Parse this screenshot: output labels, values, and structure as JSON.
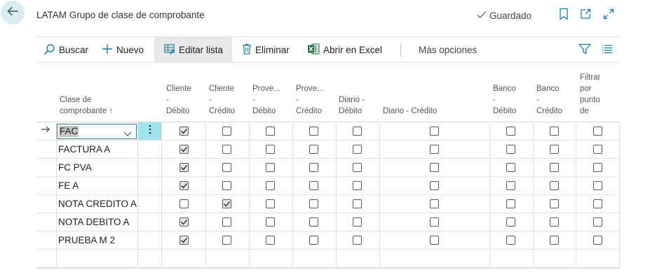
{
  "header": {
    "title": "LATAM Grupo de clase de comprobante",
    "saved_label": "Guardado"
  },
  "icons": {
    "back": "arrow-left-icon",
    "saved": "checkmark-icon",
    "bookmark": "bookmark-icon",
    "open_new": "open-in-new-window-icon",
    "expand": "expand-icon",
    "search": "search-icon",
    "new": "plus-icon",
    "edit_list": "edit-list-icon",
    "delete": "trash-icon",
    "excel": "excel-icon",
    "filter": "filter-icon",
    "list_view": "list-view-icon"
  },
  "actions": {
    "search": "Buscar",
    "new": "Nuevo",
    "edit_list": "Editar lista",
    "delete": "Eliminar",
    "excel": "Abrir en Excel",
    "more": "Más opciones"
  },
  "columns": [
    [
      "Clase de",
      "comprobante ↑"
    ],
    [
      "Cliente",
      "-",
      "Débito"
    ],
    [
      "Cliente",
      "-",
      "Crédito"
    ],
    [
      "Prove...",
      "-",
      "Débito"
    ],
    [
      "Prove...",
      "-",
      "Crédito"
    ],
    [
      "Diario -",
      "Débito"
    ],
    [
      "Diario - Crédito"
    ],
    [
      "Banco",
      "-",
      "Débito"
    ],
    [
      "Banco",
      "-",
      "Crédito"
    ],
    [
      "Filtrar",
      "por",
      "punto",
      "de"
    ]
  ],
  "rows": [
    {
      "code": "FAC",
      "checks": [
        true,
        false,
        false,
        false,
        false,
        false,
        false,
        false,
        false
      ]
    },
    {
      "code": "FACTURA A",
      "checks": [
        true,
        false,
        false,
        false,
        false,
        false,
        false,
        false,
        false
      ]
    },
    {
      "code": "FC PVA",
      "checks": [
        true,
        false,
        false,
        false,
        false,
        false,
        false,
        false,
        false
      ]
    },
    {
      "code": "FE A",
      "checks": [
        true,
        false,
        false,
        false,
        false,
        false,
        false,
        false,
        false
      ]
    },
    {
      "code": "NOTA CREDITO A",
      "checks": [
        false,
        true,
        false,
        false,
        false,
        false,
        false,
        false,
        false
      ]
    },
    {
      "code": "NOTA DEBITO A",
      "checks": [
        true,
        false,
        false,
        false,
        false,
        false,
        false,
        false,
        false
      ]
    },
    {
      "code": "PRUEBA M 2",
      "checks": [
        true,
        false,
        false,
        false,
        false,
        false,
        false,
        false,
        false
      ]
    }
  ],
  "colors": {
    "accent": "#1b7fa6",
    "back_bg": "#d6eef2",
    "active_action_bg": "#e8e8e8",
    "row_action_bg": "#9fe3ef",
    "excel_green": "#1e7145"
  }
}
